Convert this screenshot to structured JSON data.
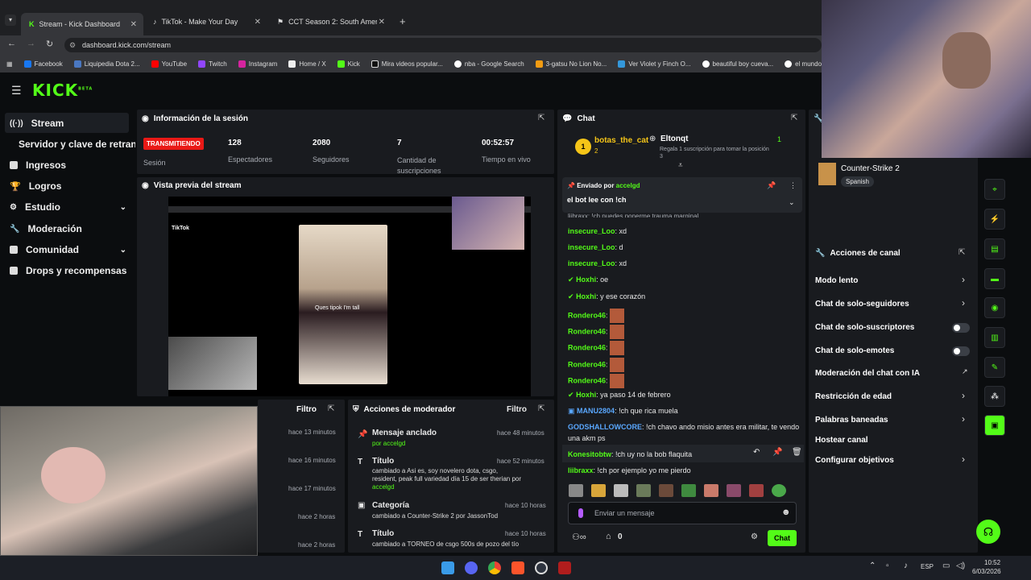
{
  "browser": {
    "tabs": [
      {
        "label": "Stream - Kick Dashboard"
      },
      {
        "label": "TikTok - Make Your Day"
      },
      {
        "label": "CCT Season 2: South America S"
      }
    ],
    "url": "dashboard.kick.com/stream",
    "bookmarks": [
      "Facebook",
      "Liquipedia Dota 2...",
      "YouTube",
      "Twitch",
      "Instagram",
      "Home / X",
      "Kick",
      "Mira videos popular...",
      "nba - Google Search",
      "3-gatsu No Lion No...",
      "Ver Violet y Finch O...",
      "beautiful boy cueva...",
      "el mundo mag"
    ]
  },
  "kick": {
    "logo": "KICK",
    "logo_sup": "BETA"
  },
  "sidebar": {
    "items": [
      {
        "label": "Stream"
      },
      {
        "label": "Servidor y clave de retransm"
      },
      {
        "label": "Ingresos"
      },
      {
        "label": "Logros"
      },
      {
        "label": "Estudio"
      },
      {
        "label": "Moderación"
      },
      {
        "label": "Comunidad"
      },
      {
        "label": "Drops y recompensas"
      }
    ]
  },
  "session": {
    "title": "Información de la sesión",
    "status": "TRANSMITIENDO",
    "status_label": "Sesión",
    "stats": [
      {
        "value": "128",
        "label": "Espectadores"
      },
      {
        "value": "2080",
        "label": "Seguidores"
      },
      {
        "value": "7",
        "label": "Cantidad de suscripciones"
      },
      {
        "value": "00:52:57",
        "label": "Tiempo en vivo"
      }
    ]
  },
  "preview": {
    "title": "Vista previa del stream",
    "overlay_text": "Ques tipok I'm tall"
  },
  "left_feed": {
    "filter": "Filtro",
    "times": [
      "hace 13 minutos",
      "hace 16 minutos",
      "hace 17 minutos",
      "hace 2 horas",
      "hace 2 horas"
    ]
  },
  "moderator": {
    "title": "Acciones de moderador",
    "filter": "Filtro",
    "rows": [
      {
        "title": "Mensaje anclado",
        "line1": "por accelgd",
        "time": "hace 48 minutos"
      },
      {
        "title": "Título",
        "line1": "cambiado a Asi es, soy novelero dota, csgo,",
        "line2": "resident, peak full variedad día 15 de ser therian por",
        "line3": "accelgd",
        "time": "hace 52 minutos"
      },
      {
        "title": "Categoría",
        "line1": "cambiado a Counter-Strike 2 por JassonTod",
        "time": "hace 10 horas"
      },
      {
        "title": "Título",
        "line1": "cambiado a TORNEO de csgo 500s de pozo del tío",
        "time": "hace 10 horas"
      }
    ]
  },
  "chat": {
    "title": "Chat",
    "top_gifter": {
      "name": "botas_the_cat",
      "count": "2"
    },
    "gift_user": "Eltonqt",
    "gift_text": "Regala 1 suscripción para tomar la posición 3",
    "gift_count": "1",
    "pinned_by_label": "Enviado por",
    "pinned_by": "accelgd",
    "pinned_text": "el bot lee con !ch",
    "cut_line": "liibraxx: !ch puedes ponerme trauma marginal",
    "messages": [
      {
        "user": "insecure_Loo",
        "text": ": xd",
        "color": "#53fc18"
      },
      {
        "user": "insecure_Loo",
        "text": ": d",
        "color": "#53fc18"
      },
      {
        "user": "insecure_Loo",
        "text": ": xd",
        "color": "#53fc18"
      },
      {
        "user": "Hoxhi",
        "text": ": oe",
        "color": "#53fc18"
      },
      {
        "user": "Hoxhi",
        "text": ": y ese corazón",
        "color": "#53fc18"
      },
      {
        "user": "Rondero46",
        "text": ":",
        "color": "#53fc18"
      },
      {
        "user": "Rondero46",
        "text": ":",
        "color": "#53fc18"
      },
      {
        "user": "Rondero46",
        "text": ":",
        "color": "#53fc18"
      },
      {
        "user": "Rondero46",
        "text": ":",
        "color": "#53fc18"
      },
      {
        "user": "Rondero46",
        "text": ":",
        "color": "#53fc18"
      },
      {
        "user": "Hoxhi",
        "text": ": ya paso 14 de febrero",
        "color": "#53fc18"
      },
      {
        "user": "MANU2804",
        "text": ": !ch que rica muela",
        "color": "#5aa8ff"
      },
      {
        "user": "GODSHALLOWCORE",
        "text": ": !ch chavo ando misio antes era militar, te vendo",
        "color": "#5aa8ff"
      },
      {
        "user": "",
        "text": "una akm ps",
        "color": "#5aa8ff"
      },
      {
        "user": "Konesitobtw",
        "text": ": !ch uy no la bob flaquita",
        "color": "#53fc18"
      },
      {
        "user": "liibraxx",
        "text": ": !ch por ejemplo yo me pierdo",
        "color": "#53fc18"
      }
    ],
    "input_placeholder": "Enviar un mensaje",
    "points": "0",
    "send_label": "Chat"
  },
  "right_panel": {
    "category": "Counter-Strike 2",
    "language": "Spanish",
    "actions_title": "Acciones de canal",
    "actions": [
      {
        "label": "Modo lento",
        "kind": "chevron"
      },
      {
        "label": "Chat de solo-seguidores",
        "kind": "chevron"
      },
      {
        "label": "Chat de solo-suscriptores",
        "kind": "toggle"
      },
      {
        "label": "Chat de solo-emotes",
        "kind": "toggle"
      },
      {
        "label": "Moderación del chat con IA",
        "kind": "external"
      },
      {
        "label": "Restricción de edad",
        "kind": "chevron"
      },
      {
        "label": "Palabras baneadas",
        "kind": "chevron"
      },
      {
        "label": "Hostear canal",
        "kind": "none"
      },
      {
        "label": "Configurar objetivos",
        "kind": "chevron"
      }
    ]
  },
  "taskbar": {
    "lang": "ESP",
    "time": "10:52",
    "date": "6/03/2026"
  },
  "colors": {
    "accent": "#53fc18",
    "live": "#e91916",
    "panel": "#191b1f"
  }
}
